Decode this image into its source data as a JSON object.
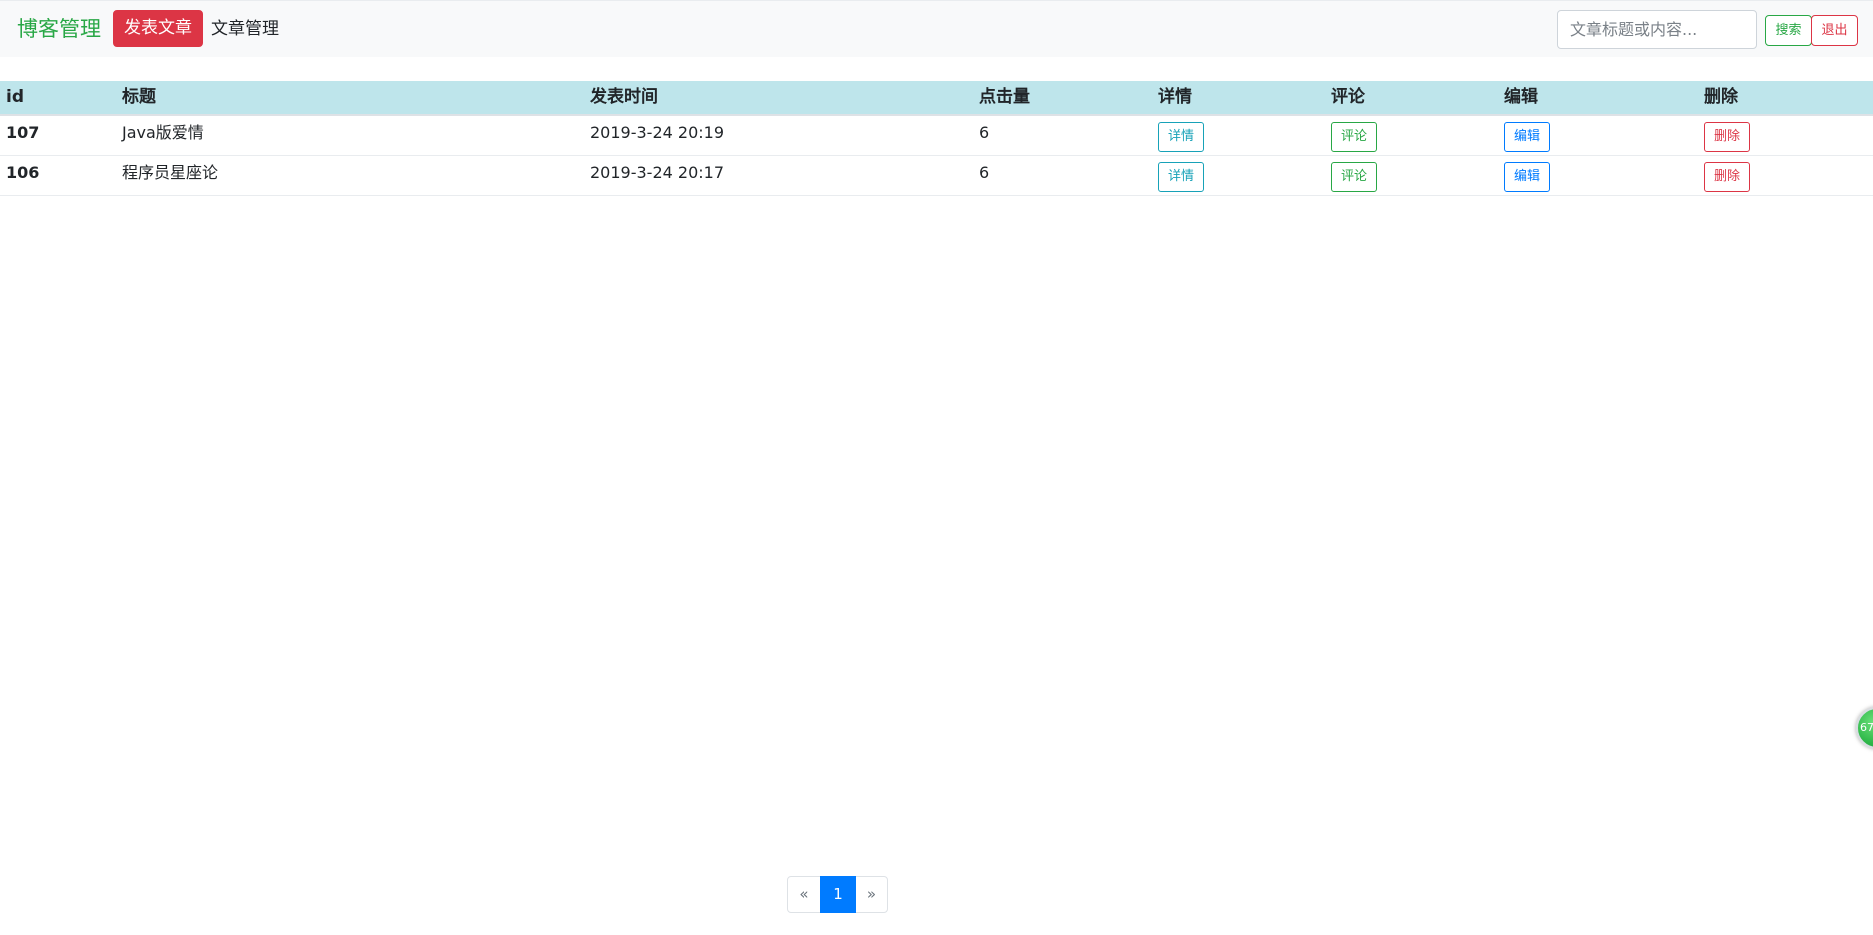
{
  "navbar": {
    "brand": "博客管理",
    "publish_label": "发表文章",
    "nav_link": "文章管理",
    "search_placeholder": "文章标题或内容...",
    "search_label": "搜索",
    "logout_label": "退出"
  },
  "table": {
    "headers": [
      "id",
      "标题",
      "发表时间",
      "点击量",
      "详情",
      "评论",
      "编辑",
      "删除"
    ],
    "rows": [
      {
        "id": "107",
        "title": "Java版爱情",
        "time": "2019-3-24 20:19",
        "clicks": "6",
        "detail": "详情",
        "comment": "评论",
        "edit": "编辑",
        "delete": "删除"
      },
      {
        "id": "106",
        "title": "程序员星座论",
        "time": "2019-3-24 20:17",
        "clicks": "6",
        "detail": "详情",
        "comment": "评论",
        "edit": "编辑",
        "delete": "删除"
      }
    ]
  },
  "pagination": {
    "prev": "«",
    "current": "1",
    "next": "»"
  },
  "float_badge": {
    "text": "67"
  },
  "colors": {
    "brand": "#28a745",
    "danger": "#dc3545",
    "primary": "#007bff",
    "info": "#17a2b8",
    "table_header_bg": "#bee5eb",
    "navbar_bg": "#f8f9fa"
  }
}
